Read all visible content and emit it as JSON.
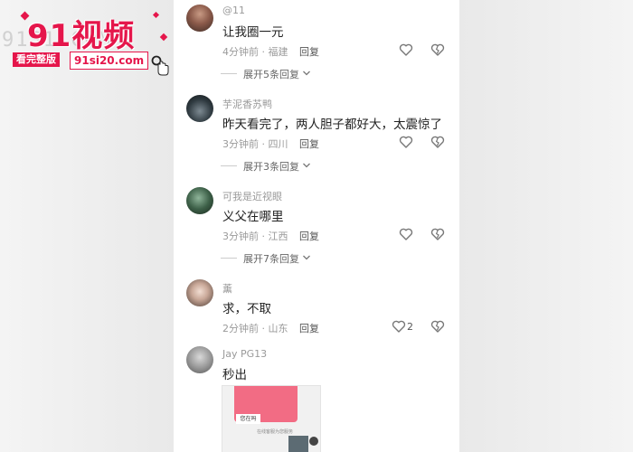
{
  "watermark": {
    "logo_text": "91视频",
    "bg_text": "91S1.COM",
    "tag": "看完整版",
    "url": "91si20.com"
  },
  "comments": [
    {
      "username": "@11",
      "text": "让我圈一元",
      "time": "4分钟前",
      "location": "福建",
      "reply_label": "回复",
      "like_count": "",
      "expand_label": "展开5条回复"
    },
    {
      "username": "芋泥香苏鸭",
      "text": "昨天看完了，两人胆子都好大，太震惊了",
      "time": "3分钟前",
      "location": "四川",
      "reply_label": "回复",
      "like_count": "",
      "expand_label": "展开3条回复"
    },
    {
      "username": "可我是近视眼",
      "text": "义父在哪里",
      "time": "3分钟前",
      "location": "江西",
      "reply_label": "回复",
      "like_count": "",
      "expand_label": "展开7条回复"
    },
    {
      "username": "薰",
      "text": "求，不取",
      "time": "2分钟前",
      "location": "山东",
      "reply_label": "回复",
      "like_count": "2",
      "expand_label": ""
    },
    {
      "username": "Jay PG13",
      "text": "秒出",
      "time": "",
      "location": "",
      "reply_label": "",
      "like_count": "",
      "expand_label": ""
    }
  ],
  "thumbnail": {
    "card_text": "您在吗",
    "caption": "在线客服为您服务"
  },
  "meta_separator": " · ",
  "icons": [
    "heart-icon",
    "broken-heart-icon",
    "chevron-down-icon",
    "search-icon",
    "hand-cursor-icon"
  ],
  "colors": {
    "brand": "#e5164b",
    "panel": "#ffffff",
    "muted": "#9a9a9a"
  }
}
